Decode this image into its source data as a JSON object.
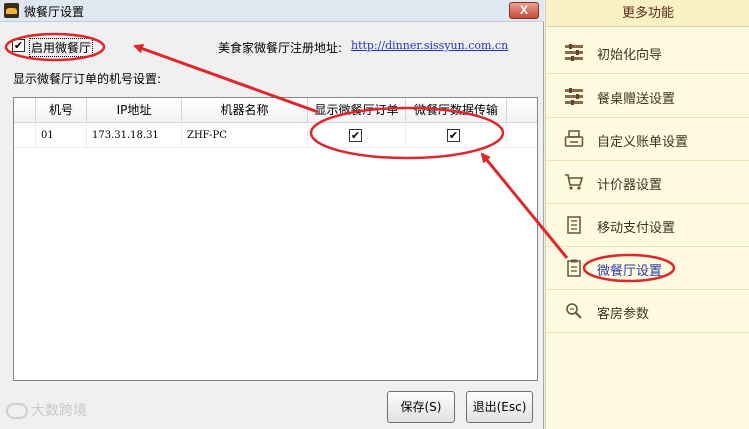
{
  "window": {
    "title": "微餐厅设置",
    "close_label": "X"
  },
  "enable_option": {
    "label": "启用微餐厅",
    "checked": true
  },
  "registration": {
    "label": "美食家微餐厅注册地址:",
    "url": "http://dinner.sissyun.com.cn"
  },
  "section_label": "显示微餐厅订单的机号设置:",
  "grid": {
    "columns": [
      "机号",
      "IP地址",
      "机器名称",
      "显示微餐厅订单",
      "微餐厅数据传输"
    ],
    "rows": [
      {
        "terminal_no": "01",
        "ip": "173.31.18.31",
        "machine_name": "ZHF-PC",
        "show_orders": true,
        "data_transfer": true
      }
    ]
  },
  "buttons": {
    "save": "保存(S)",
    "exit": "退出(Esc)"
  },
  "watermark": "大数跨境",
  "side_panel": {
    "title": "更多功能",
    "items": [
      {
        "label": "初始化向导",
        "icon": "sliders-icon"
      },
      {
        "label": "餐桌赠送设置",
        "icon": "sliders-icon"
      },
      {
        "label": "自定义账单设置",
        "icon": "printer-icon"
      },
      {
        "label": "计价器设置",
        "icon": "cart-icon"
      },
      {
        "label": "移动支付设置",
        "icon": "document-icon"
      },
      {
        "label": "微餐厅设置",
        "icon": "clipboard-icon",
        "active": true
      },
      {
        "label": "客房参数",
        "icon": "magnifier-icon"
      }
    ]
  },
  "colors": {
    "annotation": "#e0262b",
    "panel_bg": "#fffbe0",
    "link": "#1f34c4"
  }
}
